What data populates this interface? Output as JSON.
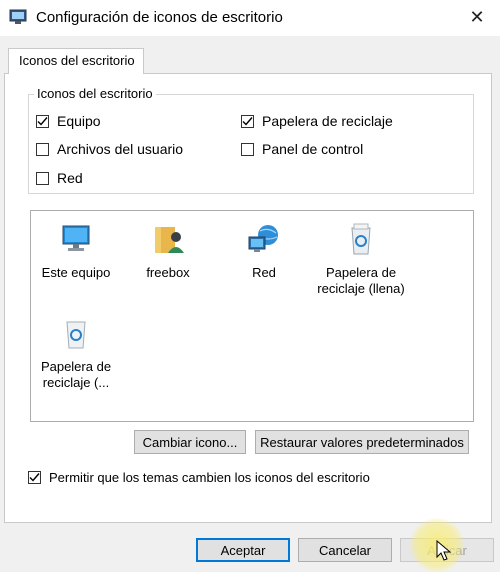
{
  "window": {
    "title": "Configuración de iconos de escritorio"
  },
  "tabs": [
    {
      "label": "Iconos del escritorio"
    }
  ],
  "desktop_icons_group": {
    "legend": "Iconos del escritorio",
    "items": [
      {
        "label": "Equipo",
        "checked": true
      },
      {
        "label": "Papelera de reciclaje",
        "checked": true
      },
      {
        "label": "Archivos del usuario",
        "checked": false
      },
      {
        "label": "Panel de control",
        "checked": false
      },
      {
        "label": "Red",
        "checked": false
      }
    ]
  },
  "icon_list": {
    "items": [
      {
        "label": "Este equipo",
        "icon": "computer-icon"
      },
      {
        "label": "freebox",
        "icon": "user-folder-icon"
      },
      {
        "label": "Red",
        "icon": "network-icon"
      },
      {
        "label": "Papelera de reciclaje (llena)",
        "icon": "recycle-bin-full-icon"
      },
      {
        "label": "Papelera de reciclaje (...",
        "icon": "recycle-bin-empty-icon"
      }
    ]
  },
  "buttons": {
    "change_icon": "Cambiar icono...",
    "restore_defaults": "Restaurar valores predeterminados",
    "accept": "Aceptar",
    "cancel": "Cancelar",
    "apply": "Aplicar"
  },
  "allow_themes": {
    "label": "Permitir que los temas cambien los iconos del escritorio",
    "checked": true
  },
  "colors": {
    "accent": "#0078d7",
    "window_bg": "#f0f0f0",
    "panel_bg": "#ffffff"
  }
}
